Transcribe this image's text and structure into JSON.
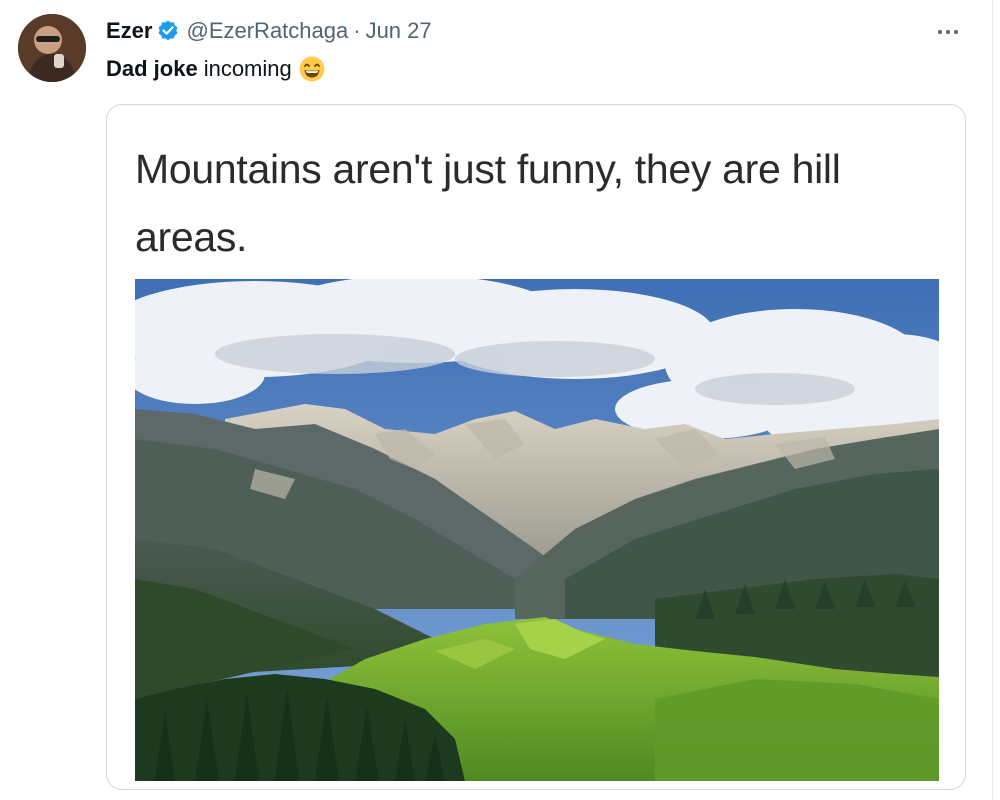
{
  "tweet": {
    "author": {
      "display_name": "Ezer",
      "handle": "@EzerRatchaga",
      "verified": true,
      "avatar_icon": "user-avatar"
    },
    "separator": "·",
    "date": "Jun 27",
    "more_icon": "more-options-icon",
    "text_bold": "Dad joke",
    "text_rest": "incoming",
    "emoji": "grinning-face-with-smiling-eyes",
    "media": {
      "caption": "Mountains aren't just funny, they are hill areas.",
      "image": "mountain-landscape-photo"
    }
  },
  "colors": {
    "text_primary": "#0f1419",
    "text_secondary": "#536471",
    "verified_blue": "#1d9bf0",
    "card_border": "#cfd9de"
  }
}
